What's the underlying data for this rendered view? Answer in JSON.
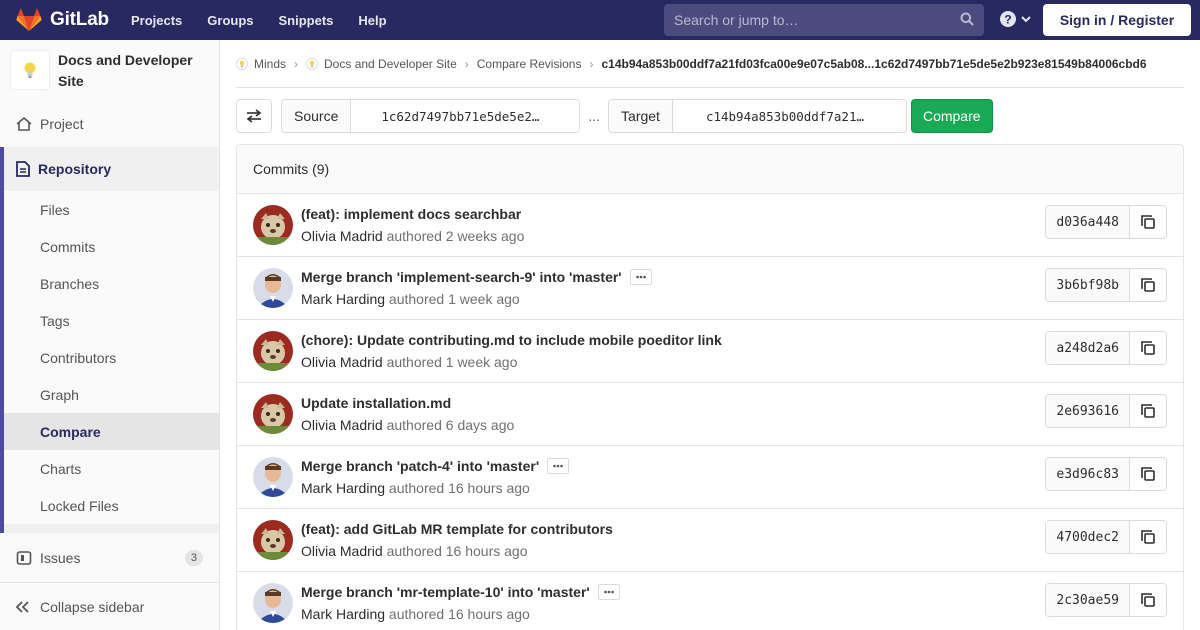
{
  "navbar": {
    "brand": "GitLab",
    "links": [
      "Projects",
      "Groups",
      "Snippets",
      "Help"
    ],
    "search_placeholder": "Search or jump to…",
    "sign_in": "Sign in / Register"
  },
  "sidebar": {
    "project_name": "Docs and Developer Site",
    "project": "Project",
    "repository": "Repository",
    "repo_items": [
      "Files",
      "Commits",
      "Branches",
      "Tags",
      "Contributors",
      "Graph",
      "Compare",
      "Charts",
      "Locked Files"
    ],
    "active_item": "Compare",
    "issues": "Issues",
    "issues_count": "3",
    "collapse": "Collapse sidebar"
  },
  "breadcrumb": {
    "group": "Minds",
    "project": "Docs and Developer Site",
    "section": "Compare Revisions",
    "current": "c14b94a853b00ddf7a21fd03fca00e9e07c5ab08...1c62d7497bb71e5de5e2b923e81549b84006cbd6"
  },
  "compare": {
    "source_label": "Source",
    "source_value": "1c62d7497bb71e5de5e2…",
    "ellipsis": "...",
    "target_label": "Target",
    "target_value": "c14b94a853b00ddf7a21…",
    "button": "Compare"
  },
  "commits": {
    "header": "Commits (9)",
    "authored": "authored",
    "items": [
      {
        "title": "(feat): implement docs searchbar",
        "author": "Olivia Madrid",
        "time": "2 weeks ago",
        "sha": "d036a448",
        "more": false,
        "avatar": "olivia"
      },
      {
        "title": "Merge branch 'implement-search-9' into 'master'",
        "author": "Mark Harding",
        "time": "1 week ago",
        "sha": "3b6bf98b",
        "more": true,
        "avatar": "mark"
      },
      {
        "title": "(chore): Update contributing.md to include mobile poeditor link",
        "author": "Olivia Madrid",
        "time": "1 week ago",
        "sha": "a248d2a6",
        "more": false,
        "avatar": "olivia"
      },
      {
        "title": "Update installation.md",
        "author": "Olivia Madrid",
        "time": "6 days ago",
        "sha": "2e693616",
        "more": false,
        "avatar": "olivia"
      },
      {
        "title": "Merge branch 'patch-4' into 'master'",
        "author": "Mark Harding",
        "time": "16 hours ago",
        "sha": "e3d96c83",
        "more": true,
        "avatar": "mark"
      },
      {
        "title": "(feat): add GitLab MR template for contributors",
        "author": "Olivia Madrid",
        "time": "16 hours ago",
        "sha": "4700dec2",
        "more": false,
        "avatar": "olivia"
      },
      {
        "title": "Merge branch 'mr-template-10' into 'master'",
        "author": "Mark Harding",
        "time": "16 hours ago",
        "sha": "2c30ae59",
        "more": true,
        "avatar": "mark"
      }
    ]
  },
  "colors": {
    "navbar": "#292961",
    "accent": "#4b4ba3",
    "compare_button": "#1aaa55"
  },
  "icons": [
    "gitlab-logo-icon",
    "search-icon",
    "help-icon",
    "chevron-down-icon",
    "lightbulb-icon",
    "home-icon",
    "document-icon",
    "issues-icon",
    "collapse-icon",
    "swap-icon",
    "copy-icon",
    "ellipsis-icon"
  ]
}
